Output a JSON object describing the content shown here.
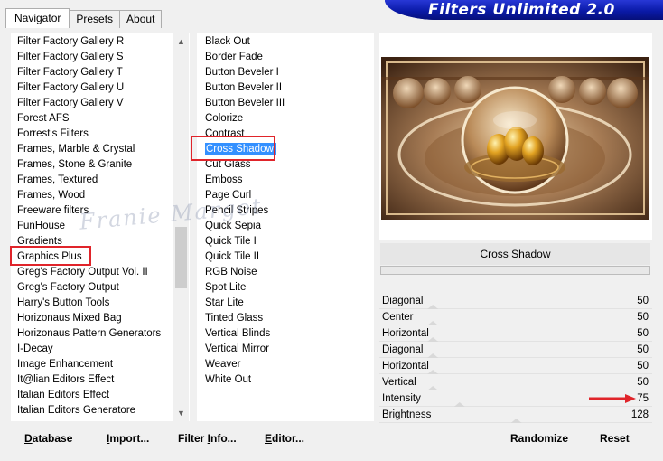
{
  "banner": {
    "title": "Filters Unlimited 2.0"
  },
  "tabs": [
    {
      "label": "Navigator",
      "active": true
    },
    {
      "label": "Presets",
      "active": false
    },
    {
      "label": "About",
      "active": false
    }
  ],
  "categories": [
    "Filter Factory Gallery R",
    "Filter Factory Gallery S",
    "Filter Factory Gallery T",
    "Filter Factory Gallery U",
    "Filter Factory Gallery V",
    "Forest AFS",
    "Forrest's Filters",
    "Frames, Marble & Crystal",
    "Frames, Stone & Granite",
    "Frames, Textured",
    "Frames, Wood",
    "Freeware filters",
    "FunHouse",
    "Gradients",
    "Graphics Plus",
    "Greg's Factory Output Vol. II",
    "Greg's Factory Output",
    "Harry's Button Tools",
    "Horizonaus Mixed Bag",
    "Horizonaus Pattern Generators",
    "I-Decay",
    "Image Enhancement",
    "It@lian Editors Effect",
    "Italian Editors Effect",
    "Italian Editors Generatore"
  ],
  "filters": [
    "Black Out",
    "Border Fade",
    "Button Beveler I",
    "Button Beveler II",
    "Button Beveler III",
    "Colorize",
    "Contrast",
    "Cross Shadow",
    "Cut Glass",
    "Emboss",
    "Page Curl",
    "Pencil Stripes",
    "Quick Sepia",
    "Quick Tile I",
    "Quick Tile II",
    "RGB Noise",
    "Spot Lite",
    "Star Lite",
    "Tinted Glass",
    "Vertical Blinds",
    "Vertical Mirror",
    "Weaver",
    "White Out"
  ],
  "selected_category": "Graphics Plus",
  "selected_filter": "Cross Shadow",
  "current_filter_name": "Cross Shadow",
  "sliders": [
    {
      "label": "Diagonal",
      "value": 50,
      "level": 0.196
    },
    {
      "label": "Center",
      "value": 50,
      "level": 0.196
    },
    {
      "label": "Horizontal",
      "value": 50,
      "level": 0.196
    },
    {
      "label": "Diagonal",
      "value": 50,
      "level": 0.196
    },
    {
      "label": "Horizontal",
      "value": 50,
      "level": 0.196
    },
    {
      "label": "Vertical",
      "value": 50,
      "level": 0.196
    },
    {
      "label": "Intensity",
      "value": 75,
      "level": 0.294
    },
    {
      "label": "Brightness",
      "value": 128,
      "level": 0.502
    }
  ],
  "buttons": {
    "database": {
      "u": "D",
      "rest": "atabase"
    },
    "import": {
      "u": "I",
      "rest": "mport..."
    },
    "filter_info": {
      "pre": "Filter ",
      "u": "I",
      "rest": "nfo..."
    },
    "editor": {
      "u": "E",
      "rest": "ditor..."
    },
    "randomize": "Randomize",
    "reset": "Reset"
  },
  "watermark": "Franie Margot",
  "colors": {
    "selection": "#3390ff",
    "highlight": "#e0242a",
    "banner": "#0a1aa8"
  }
}
